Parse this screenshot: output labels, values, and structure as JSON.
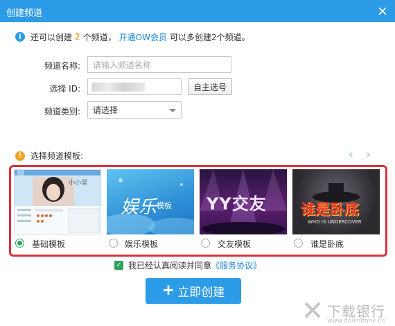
{
  "window": {
    "title": "创建频道"
  },
  "info": {
    "prefix": "还可以创建",
    "count": "2",
    "middle": "个频道，",
    "link": "开通OW会员",
    "suffix": "可以多创建2个频道。"
  },
  "form": {
    "name_label": "频道名称:",
    "name_placeholder": "请输入频道名称",
    "id_label": "选择 ID:",
    "id_button": "自主选号",
    "category_label": "频道类别:",
    "category_value": "请选择"
  },
  "templates": {
    "heading": "选择频道模板:",
    "items": [
      {
        "label": "基础模板",
        "selected": true,
        "thumb_text": "小小淫"
      },
      {
        "label": "娱乐模板",
        "selected": false,
        "thumb_text": "娱乐",
        "thumb_sub": "模板"
      },
      {
        "label": "交友模板",
        "selected": false,
        "thumb_text": "YY交友"
      },
      {
        "label": "谁是卧底",
        "selected": false,
        "thumb_text": "谁是卧底",
        "thumb_sub": "WHO IS UNDERCOVER"
      }
    ]
  },
  "agreement": {
    "text": "我已经认真阅读并同意",
    "link": "《服务协议》",
    "checked": true
  },
  "create_button": "立即创建",
  "watermark": {
    "main": "下载银行",
    "sub": "www.downbank.cn"
  },
  "colors": {
    "accent": "#2c9be8",
    "orange": "#ff8a00",
    "highlight": "#d7303a",
    "green": "#2ca35c"
  },
  "icons": [
    "close-icon",
    "info-icon",
    "warning-icon",
    "chevron-left-icon",
    "chevron-right-icon",
    "plus-icon",
    "checkbox-icon"
  ]
}
